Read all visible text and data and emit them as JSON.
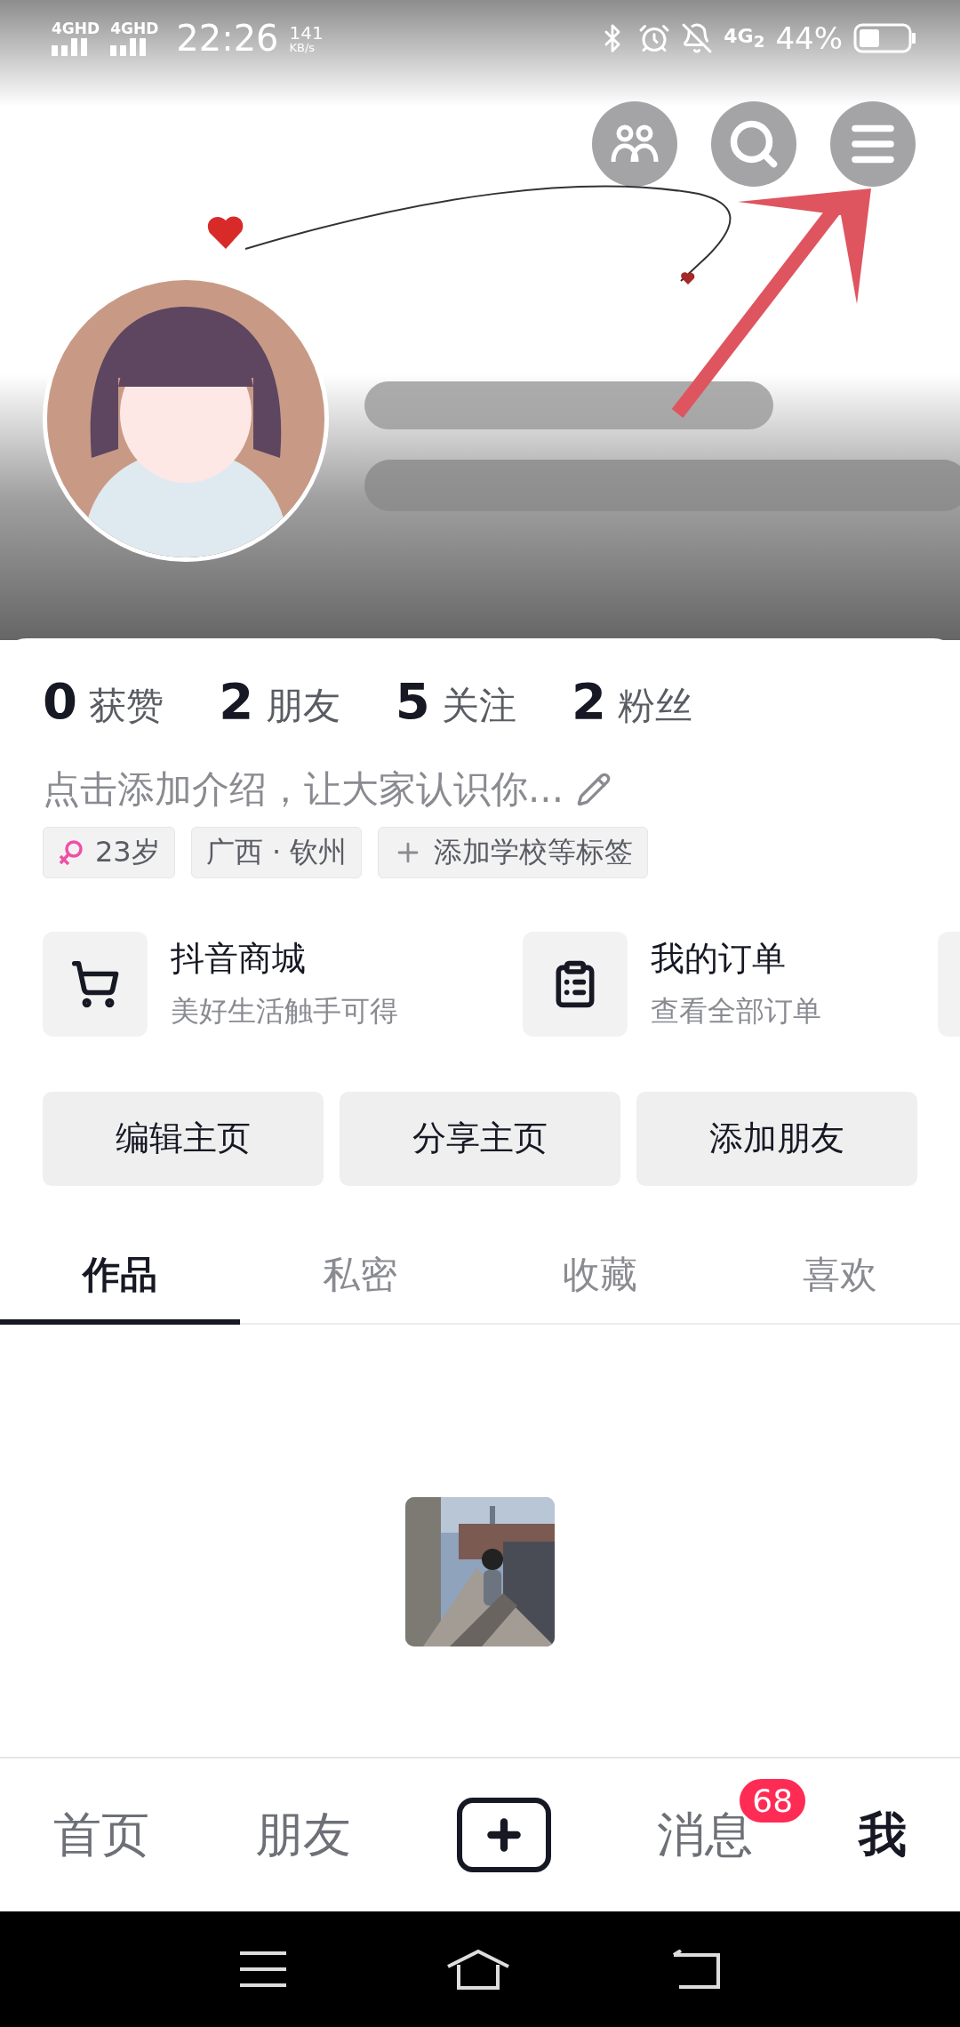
{
  "status_bar": {
    "networks": [
      "4GHD",
      "4GHD"
    ],
    "time": "22:26",
    "speed_value": "141",
    "speed_unit": "KB/s",
    "network_type": "4G$_{2}$",
    "battery": "44%"
  },
  "header": {
    "actions": [
      {
        "kind": "friends"
      },
      {
        "kind": "search"
      },
      {
        "kind": "menu"
      }
    ]
  },
  "stats": [
    "**0** 获赞",
    "**2** 朋友",
    "**5** 关注",
    "**2** 粉丝"
  ],
  "bio": {
    "placeholder": "点击添加介绍，让大家认识你..."
  },
  "tags": [
    {
      "kind": "gender",
      "text": "23岁"
    },
    {
      "kind": "location",
      "text": "广西 · 钦州"
    },
    {
      "kind": "add",
      "text": "添加学校等标签"
    }
  ],
  "services": [
    {
      "kind": "cart",
      "title": "抖音商城",
      "subtitle": "美好生活触手可得"
    },
    {
      "kind": "clipboard",
      "title": "我的订单",
      "subtitle": "查看全部订单"
    },
    {
      "kind": "other"
    }
  ],
  "buttons": [
    "编辑主页",
    "分享主页",
    "添加朋友"
  ],
  "tabs": [
    {
      "label": "作品",
      "selected": true
    },
    {
      "label": "私密",
      "selected": false
    },
    {
      "label": "收藏",
      "selected": false
    },
    {
      "label": "喜欢",
      "selected": false
    }
  ],
  "content": {
    "kind": "picture"
  },
  "bottom_nav": [
    {
      "kind": "text",
      "label": "首页",
      "selected": false
    },
    {
      "kind": "text",
      "label": "朋友",
      "selected": false
    },
    {
      "kind": "plus"
    },
    {
      "kind": "text",
      "label": "消息",
      "selected": false,
      "badge": "68"
    },
    {
      "kind": "text",
      "label": "我",
      "selected": true
    }
  ],
  "system_nav": [
    {
      "kind": "menu"
    },
    {
      "kind": "home"
    },
    {
      "kind": "back"
    }
  ]
}
